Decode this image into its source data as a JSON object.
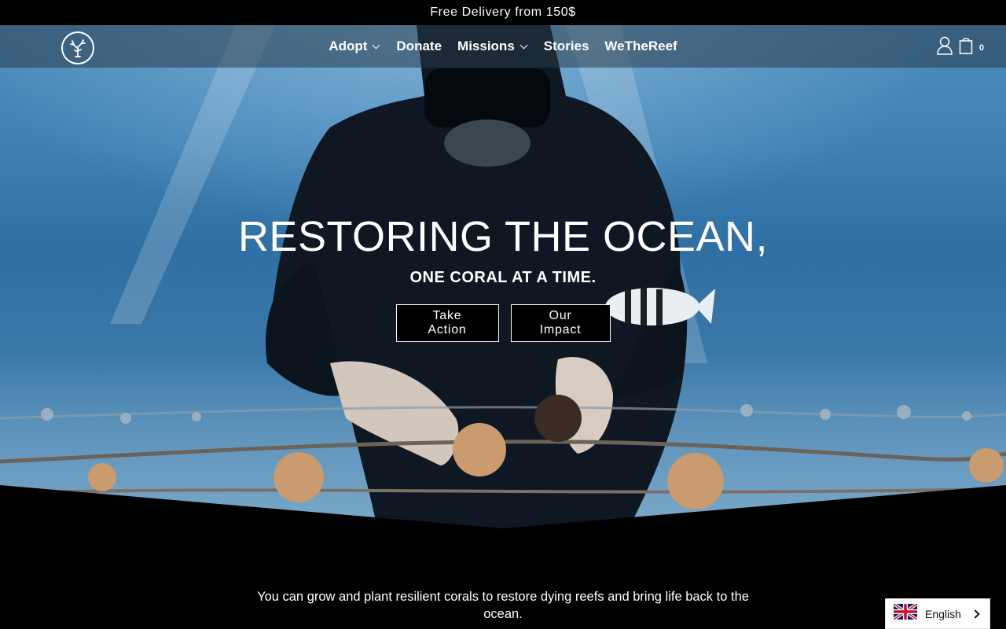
{
  "announcement": "Free Delivery from 150$",
  "nav": {
    "logo_alt": "coral-logo",
    "items": [
      {
        "label": "Adopt",
        "dropdown": true
      },
      {
        "label": "Donate",
        "dropdown": false
      },
      {
        "label": "Missions",
        "dropdown": true
      },
      {
        "label": "Stories",
        "dropdown": false
      },
      {
        "label": "WeTheReef",
        "dropdown": false
      }
    ],
    "cart_count": "0"
  },
  "hero": {
    "title": "RESTORING THE OCEAN,",
    "subtitle": "ONE CORAL AT A TIME.",
    "cta_primary": "Take Action",
    "cta_secondary": "Our Impact"
  },
  "intro": "You can grow and plant resilient corals to restore dying reefs and bring life back to the ocean.",
  "language": {
    "label": "English",
    "flag": "uk-flag-icon"
  },
  "colors": {
    "page_bg": "#000000",
    "nav_overlay": "rgba(40,58,75,0.55)",
    "water": "#3e80b3",
    "button_bg": "#000000"
  }
}
